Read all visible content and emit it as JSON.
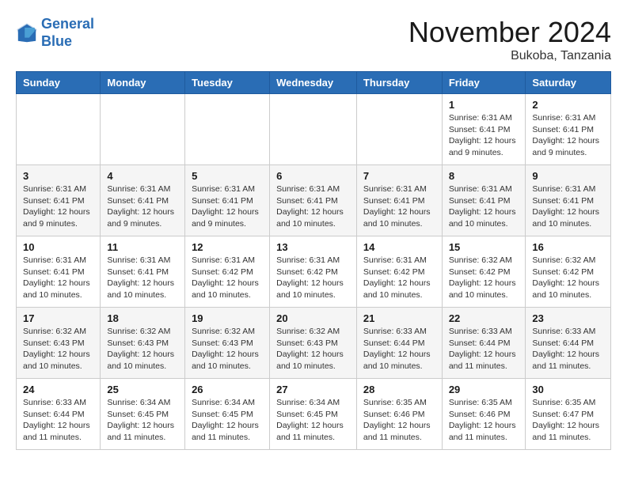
{
  "logo": {
    "line1": "General",
    "line2": "Blue"
  },
  "title": "November 2024",
  "location": "Bukoba, Tanzania",
  "days_of_week": [
    "Sunday",
    "Monday",
    "Tuesday",
    "Wednesday",
    "Thursday",
    "Friday",
    "Saturday"
  ],
  "weeks": [
    [
      {
        "num": "",
        "info": ""
      },
      {
        "num": "",
        "info": ""
      },
      {
        "num": "",
        "info": ""
      },
      {
        "num": "",
        "info": ""
      },
      {
        "num": "",
        "info": ""
      },
      {
        "num": "1",
        "info": "Sunrise: 6:31 AM\nSunset: 6:41 PM\nDaylight: 12 hours\nand 9 minutes."
      },
      {
        "num": "2",
        "info": "Sunrise: 6:31 AM\nSunset: 6:41 PM\nDaylight: 12 hours\nand 9 minutes."
      }
    ],
    [
      {
        "num": "3",
        "info": "Sunrise: 6:31 AM\nSunset: 6:41 PM\nDaylight: 12 hours\nand 9 minutes."
      },
      {
        "num": "4",
        "info": "Sunrise: 6:31 AM\nSunset: 6:41 PM\nDaylight: 12 hours\nand 9 minutes."
      },
      {
        "num": "5",
        "info": "Sunrise: 6:31 AM\nSunset: 6:41 PM\nDaylight: 12 hours\nand 9 minutes."
      },
      {
        "num": "6",
        "info": "Sunrise: 6:31 AM\nSunset: 6:41 PM\nDaylight: 12 hours\nand 10 minutes."
      },
      {
        "num": "7",
        "info": "Sunrise: 6:31 AM\nSunset: 6:41 PM\nDaylight: 12 hours\nand 10 minutes."
      },
      {
        "num": "8",
        "info": "Sunrise: 6:31 AM\nSunset: 6:41 PM\nDaylight: 12 hours\nand 10 minutes."
      },
      {
        "num": "9",
        "info": "Sunrise: 6:31 AM\nSunset: 6:41 PM\nDaylight: 12 hours\nand 10 minutes."
      }
    ],
    [
      {
        "num": "10",
        "info": "Sunrise: 6:31 AM\nSunset: 6:41 PM\nDaylight: 12 hours\nand 10 minutes."
      },
      {
        "num": "11",
        "info": "Sunrise: 6:31 AM\nSunset: 6:41 PM\nDaylight: 12 hours\nand 10 minutes."
      },
      {
        "num": "12",
        "info": "Sunrise: 6:31 AM\nSunset: 6:42 PM\nDaylight: 12 hours\nand 10 minutes."
      },
      {
        "num": "13",
        "info": "Sunrise: 6:31 AM\nSunset: 6:42 PM\nDaylight: 12 hours\nand 10 minutes."
      },
      {
        "num": "14",
        "info": "Sunrise: 6:31 AM\nSunset: 6:42 PM\nDaylight: 12 hours\nand 10 minutes."
      },
      {
        "num": "15",
        "info": "Sunrise: 6:32 AM\nSunset: 6:42 PM\nDaylight: 12 hours\nand 10 minutes."
      },
      {
        "num": "16",
        "info": "Sunrise: 6:32 AM\nSunset: 6:42 PM\nDaylight: 12 hours\nand 10 minutes."
      }
    ],
    [
      {
        "num": "17",
        "info": "Sunrise: 6:32 AM\nSunset: 6:43 PM\nDaylight: 12 hours\nand 10 minutes."
      },
      {
        "num": "18",
        "info": "Sunrise: 6:32 AM\nSunset: 6:43 PM\nDaylight: 12 hours\nand 10 minutes."
      },
      {
        "num": "19",
        "info": "Sunrise: 6:32 AM\nSunset: 6:43 PM\nDaylight: 12 hours\nand 10 minutes."
      },
      {
        "num": "20",
        "info": "Sunrise: 6:32 AM\nSunset: 6:43 PM\nDaylight: 12 hours\nand 10 minutes."
      },
      {
        "num": "21",
        "info": "Sunrise: 6:33 AM\nSunset: 6:44 PM\nDaylight: 12 hours\nand 10 minutes."
      },
      {
        "num": "22",
        "info": "Sunrise: 6:33 AM\nSunset: 6:44 PM\nDaylight: 12 hours\nand 11 minutes."
      },
      {
        "num": "23",
        "info": "Sunrise: 6:33 AM\nSunset: 6:44 PM\nDaylight: 12 hours\nand 11 minutes."
      }
    ],
    [
      {
        "num": "24",
        "info": "Sunrise: 6:33 AM\nSunset: 6:44 PM\nDaylight: 12 hours\nand 11 minutes."
      },
      {
        "num": "25",
        "info": "Sunrise: 6:34 AM\nSunset: 6:45 PM\nDaylight: 12 hours\nand 11 minutes."
      },
      {
        "num": "26",
        "info": "Sunrise: 6:34 AM\nSunset: 6:45 PM\nDaylight: 12 hours\nand 11 minutes."
      },
      {
        "num": "27",
        "info": "Sunrise: 6:34 AM\nSunset: 6:45 PM\nDaylight: 12 hours\nand 11 minutes."
      },
      {
        "num": "28",
        "info": "Sunrise: 6:35 AM\nSunset: 6:46 PM\nDaylight: 12 hours\nand 11 minutes."
      },
      {
        "num": "29",
        "info": "Sunrise: 6:35 AM\nSunset: 6:46 PM\nDaylight: 12 hours\nand 11 minutes."
      },
      {
        "num": "30",
        "info": "Sunrise: 6:35 AM\nSunset: 6:47 PM\nDaylight: 12 hours\nand 11 minutes."
      }
    ]
  ]
}
